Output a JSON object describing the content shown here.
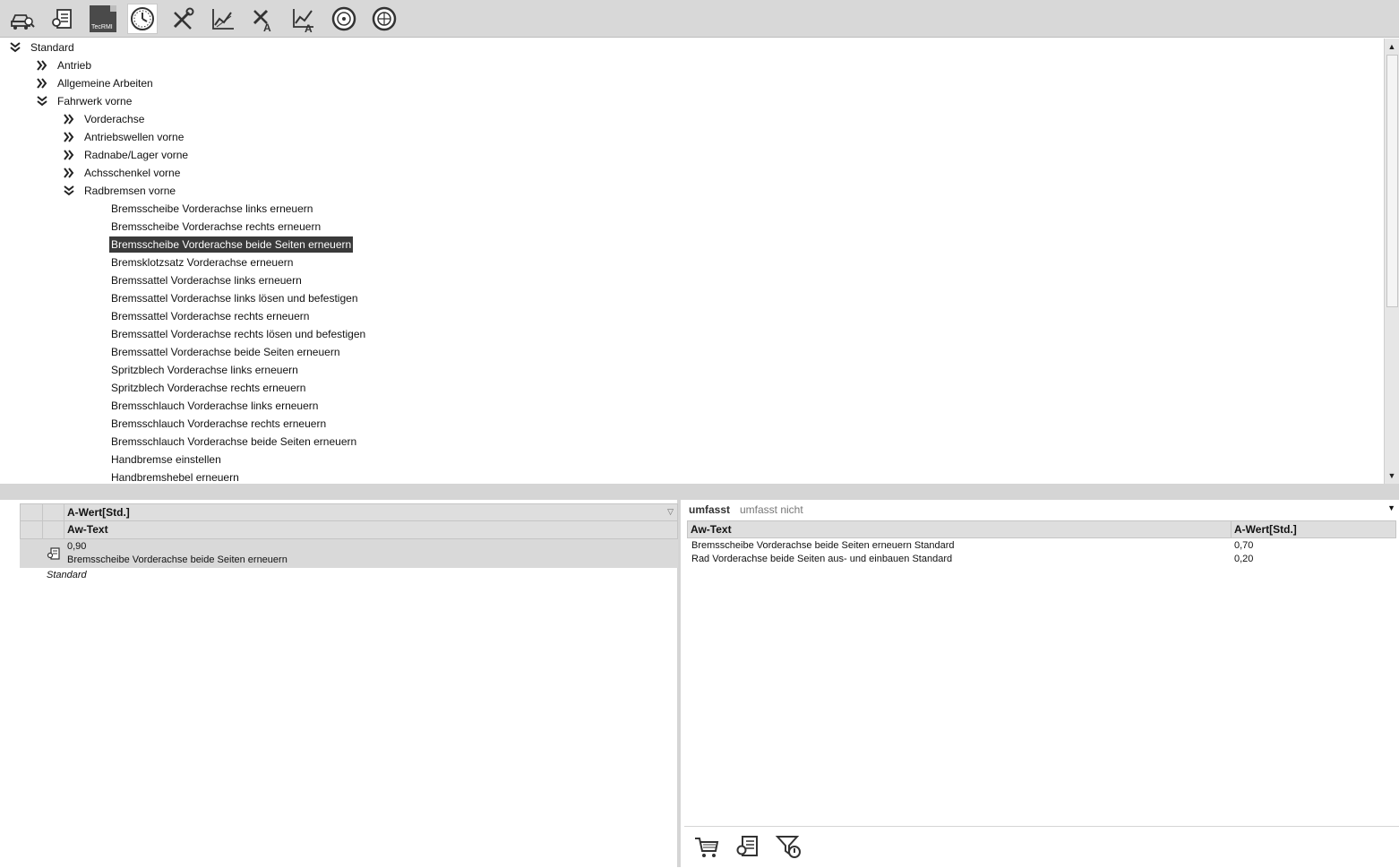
{
  "toolbar": {
    "buttons": [
      {
        "icon": "vehicle-search-icon"
      },
      {
        "icon": "service-document-icon"
      },
      {
        "icon": "tecrmi-logo-icon",
        "label": "TecRMI"
      },
      {
        "icon": "clock-icon",
        "active": true
      },
      {
        "icon": "tools-icon"
      },
      {
        "icon": "chart-icon"
      },
      {
        "icon": "tools-a-icon"
      },
      {
        "icon": "chart-a-icon"
      },
      {
        "icon": "wheel-icon"
      },
      {
        "icon": "wheel-alt-icon"
      }
    ]
  },
  "tree": {
    "items": [
      {
        "label": "Standard",
        "level": 0,
        "state": "expanded"
      },
      {
        "label": "Antrieb",
        "level": 1,
        "state": "collapsed"
      },
      {
        "label": "Allgemeine Arbeiten",
        "level": 1,
        "state": "collapsed"
      },
      {
        "label": "Fahrwerk vorne",
        "level": 1,
        "state": "expanded"
      },
      {
        "label": "Vorderachse",
        "level": 2,
        "state": "collapsed"
      },
      {
        "label": "Antriebswellen vorne",
        "level": 2,
        "state": "collapsed"
      },
      {
        "label": "Radnabe/Lager vorne",
        "level": 2,
        "state": "collapsed"
      },
      {
        "label": "Achsschenkel vorne",
        "level": 2,
        "state": "collapsed"
      },
      {
        "label": "Radbremsen vorne",
        "level": 2,
        "state": "expanded"
      },
      {
        "label": "Bremsscheibe Vorderachse links erneuern",
        "level": 3,
        "state": "leaf"
      },
      {
        "label": "Bremsscheibe Vorderachse rechts erneuern",
        "level": 3,
        "state": "leaf"
      },
      {
        "label": "Bremsscheibe Vorderachse beide Seiten erneuern",
        "level": 3,
        "state": "leaf",
        "selected": true
      },
      {
        "label": "Bremsklotzsatz Vorderachse erneuern",
        "level": 3,
        "state": "leaf"
      },
      {
        "label": "Bremssattel Vorderachse links erneuern",
        "level": 3,
        "state": "leaf"
      },
      {
        "label": "Bremssattel Vorderachse links lösen und befestigen",
        "level": 3,
        "state": "leaf"
      },
      {
        "label": "Bremssattel Vorderachse rechts erneuern",
        "level": 3,
        "state": "leaf"
      },
      {
        "label": "Bremssattel Vorderachse rechts lösen und befestigen",
        "level": 3,
        "state": "leaf"
      },
      {
        "label": "Bremssattel Vorderachse beide Seiten erneuern",
        "level": 3,
        "state": "leaf"
      },
      {
        "label": "Spritzblech Vorderachse links erneuern",
        "level": 3,
        "state": "leaf"
      },
      {
        "label": "Spritzblech Vorderachse rechts erneuern",
        "level": 3,
        "state": "leaf"
      },
      {
        "label": "Bremsschlauch Vorderachse links erneuern",
        "level": 3,
        "state": "leaf"
      },
      {
        "label": "Bremsschlauch Vorderachse rechts erneuern",
        "level": 3,
        "state": "leaf"
      },
      {
        "label": "Bremsschlauch Vorderachse beide Seiten erneuern",
        "level": 3,
        "state": "leaf"
      },
      {
        "label": "Handbremse einstellen",
        "level": 3,
        "state": "leaf"
      },
      {
        "label": "Handbremshebel erneuern",
        "level": 3,
        "state": "leaf"
      }
    ]
  },
  "left_table": {
    "header_value": "A-Wert[Std.]",
    "header_text": "Aw-Text",
    "rows": [
      {
        "value": "0,90",
        "text": "Bremsscheibe Vorderachse beide Seiten erneuern",
        "icon": "service-document-icon"
      }
    ],
    "group_label": "Standard"
  },
  "right_panel": {
    "filter": {
      "includes": "umfasst",
      "excludes": "umfasst nicht"
    },
    "columns": [
      "Aw-Text",
      "A-Wert[Std.]"
    ],
    "rows": [
      {
        "text": "Bremsscheibe Vorderachse beide Seiten erneuern Standard",
        "value": "0,70"
      },
      {
        "text": "Rad Vorderachse beide Seiten aus- und einbauen Standard",
        "value": "0,20"
      }
    ],
    "actions": [
      {
        "icon": "cart-icon"
      },
      {
        "icon": "service-document-icon"
      },
      {
        "icon": "filter-reset-icon"
      }
    ]
  },
  "colors": {
    "toolbar_bg": "#d8d8d8",
    "selection_bg": "#3a3a3a",
    "header_bg": "#dedede",
    "row_highlight": "#d9d9d9"
  }
}
